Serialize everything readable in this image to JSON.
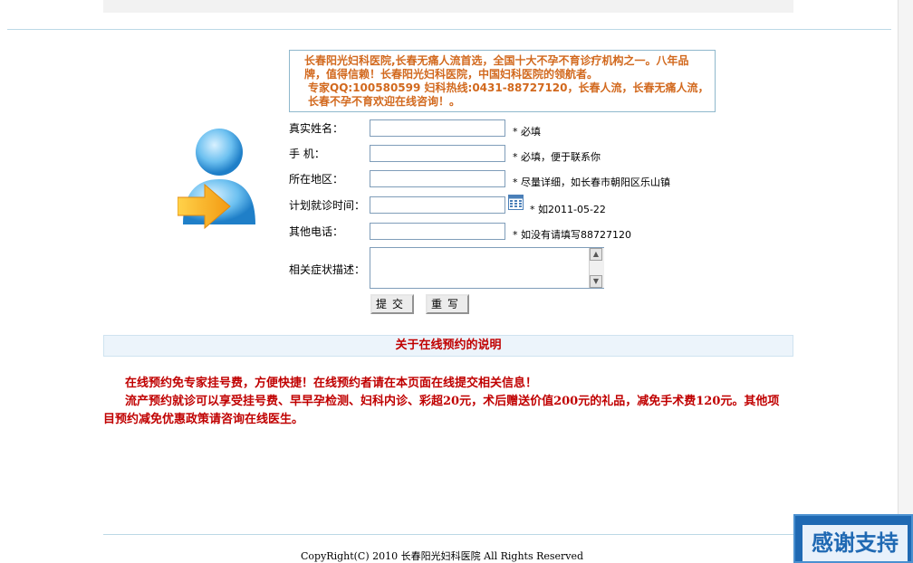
{
  "notice": {
    "line1": "长春阳光妇科医院,长春无痛人流首选，全国十大不孕不育诊疗机构之一。八年品牌，值得信赖！长春阳光妇科医院，中国妇科医院的领航者。",
    "line2": "专家QQ:100580599 妇科热线:0431-88727120，长春人流，长春无痛人流，长春不孕不育欢迎在线咨询！。"
  },
  "form": {
    "name_label": "真实姓名：",
    "name_hint": "* 必填",
    "phone_label": "手    机：",
    "phone_hint": "* 必填，便于联系你",
    "region_label": "所在地区：",
    "region_hint": "* 尽量详细，如长春市朝阳区乐山镇",
    "date_label": "计划就诊时间：",
    "date_hint": "* 如2011-05-22",
    "other_phone_label": "其他电话：",
    "other_phone_hint": "* 如没有请填写88727120",
    "symptom_label": "相关症状描述：",
    "submit_label": "提交",
    "reset_label": "重写"
  },
  "section": {
    "title": "关于在线预约的说明",
    "para1": "在线预约免专家挂号费，方便快捷！在线预约者请在本页面在线提交相关信息！",
    "para2": "流产预约就诊可以享受挂号费、早早孕检测、妇科内诊、彩超20元，术后赠送价值200元的礼品，减免手术费120元。其他项目预约减免优惠政策请咨询在线医生。"
  },
  "footer": {
    "copyright": "CopyRight(C) 2010 长春阳光妇科医院 All Rights Reserved"
  },
  "badge": {
    "text": "感谢支持"
  },
  "icons": {
    "avatar": "user-arrow-icon",
    "calendar": "calendar-icon"
  },
  "colors": {
    "notice_text": "#d2691e",
    "section_text": "#c00000",
    "badge_bg": "#1f69b3"
  }
}
